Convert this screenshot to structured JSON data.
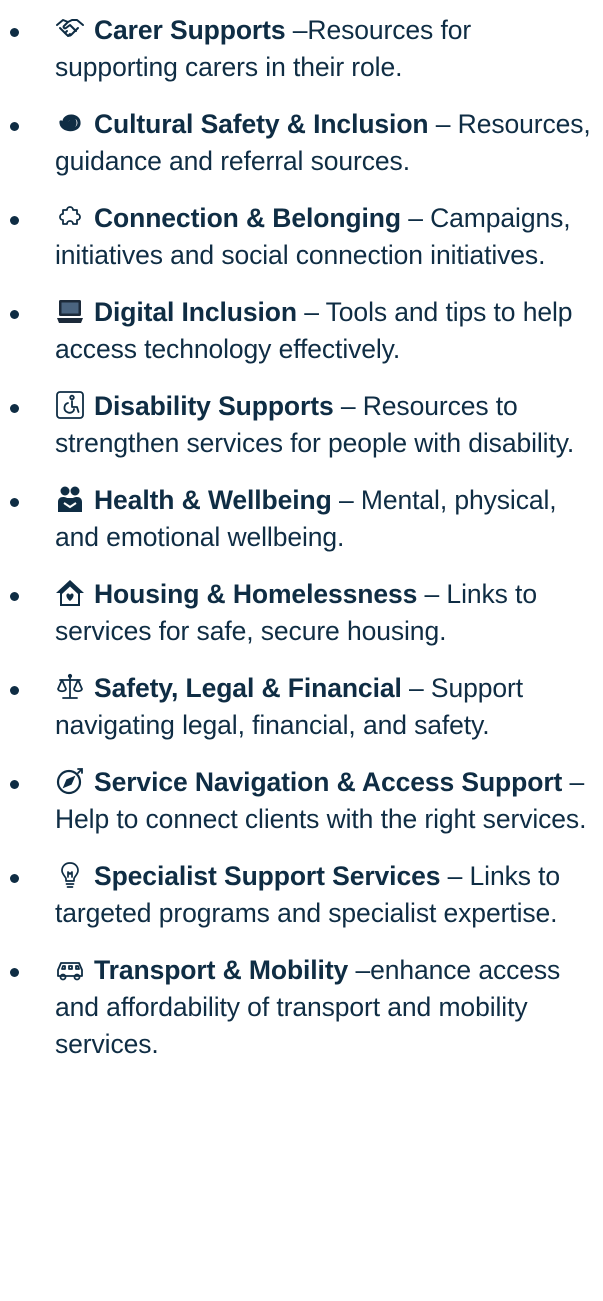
{
  "items": [
    {
      "icon": "handshake-icon",
      "title": "Carer Supports",
      "desc": " –Resources for supporting carers in their role."
    },
    {
      "icon": "spiral-icon",
      "title": "Cultural Safety & Inclusion",
      "desc": " – Resources, guidance and referral sources."
    },
    {
      "icon": "puzzle-icon",
      "title": "Connection & Belonging",
      "desc": " – Campaigns, initiatives and social connection initiatives."
    },
    {
      "icon": "laptop-icon",
      "title": "Digital Inclusion",
      "desc": " – Tools and tips to help access technology effectively."
    },
    {
      "icon": "accessibility-icon",
      "title": "Disability Supports",
      "desc": " – Resources to strengthen services for people with disability."
    },
    {
      "icon": "person-hug-icon",
      "title": "Health & Wellbeing",
      "desc": " – Mental, physical, and emotional wellbeing."
    },
    {
      "icon": "house-icon",
      "title": "Housing & Homelessness",
      "desc": " – Links to services for safe, secure housing."
    },
    {
      "icon": "scales-icon",
      "title": "Safety, Legal & Financial",
      "desc": " – Support navigating legal, financial, and safety."
    },
    {
      "icon": "compass-icon",
      "title": "Service Navigation & Access Support",
      "desc": " – Help to connect clients with the right services."
    },
    {
      "icon": "lightbulb-icon",
      "title": "Specialist Support Services",
      "desc": " – Links to targeted programs and specialist expertise."
    },
    {
      "icon": "car-icon",
      "title": "Transport & Mobility",
      "desc": " –enhance access and affordability of transport and mobility services."
    }
  ],
  "colors": {
    "text": "#0f2d44"
  }
}
